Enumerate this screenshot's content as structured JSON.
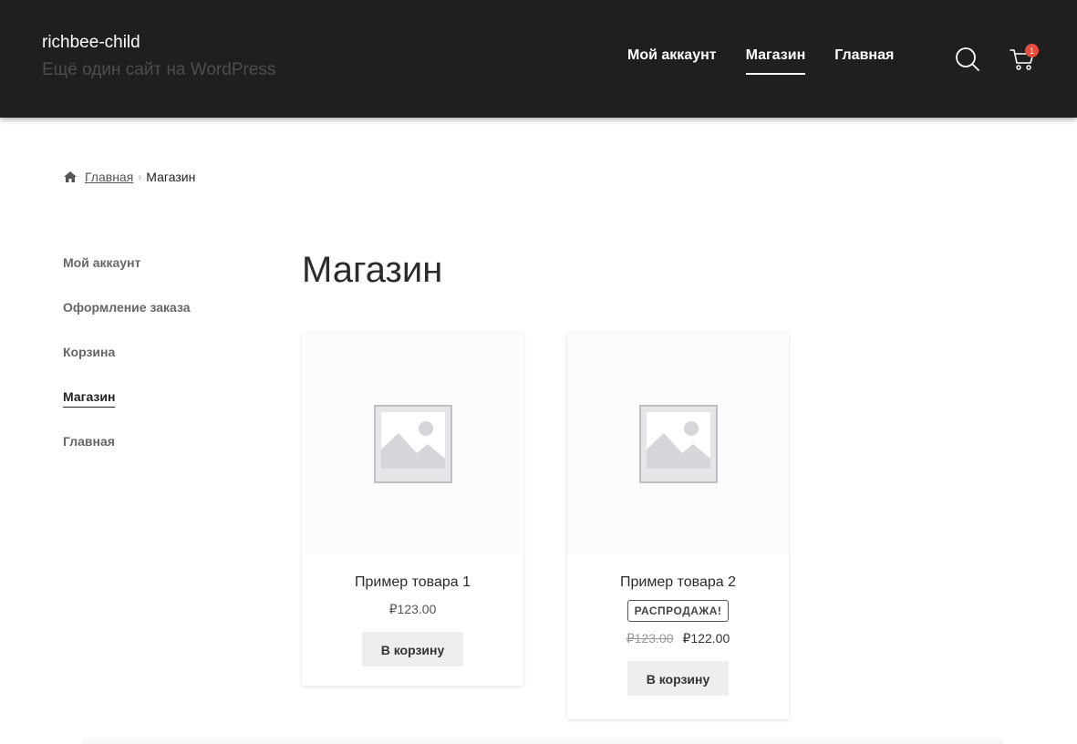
{
  "header": {
    "site_title": "richbee-child",
    "site_description": "Ещё один сайт на WordPress",
    "nav": [
      {
        "label": "Мой аккаунт",
        "active": false
      },
      {
        "label": "Магазин",
        "active": true
      },
      {
        "label": "Главная",
        "active": false
      }
    ],
    "search_icon": "search-icon",
    "cart_icon": "cart-icon",
    "cart_count": "1"
  },
  "breadcrumb": {
    "home_icon": "home-icon",
    "home_label": "Главная",
    "separator": "›",
    "current": "Магазин"
  },
  "sidebar": {
    "items": [
      {
        "label": "Мой аккаунт"
      },
      {
        "label": "Оформление заказа"
      },
      {
        "label": "Корзина"
      },
      {
        "label": "Магазин",
        "active": true
      },
      {
        "label": "Главная"
      }
    ]
  },
  "main": {
    "title": "Магазин",
    "products": [
      {
        "name": "Пример товара 1",
        "price": "₽123.00",
        "button": "В корзину"
      },
      {
        "name": "Пример товара 2",
        "sale_badge": "РАСПРОДАЖА!",
        "old_price": "₽123.00",
        "price": "₽122.00",
        "button": "В корзину"
      }
    ]
  },
  "colors": {
    "header_bg": "#1f1f1f",
    "badge": "#e74c3c",
    "button_bg": "#eeeeee"
  }
}
